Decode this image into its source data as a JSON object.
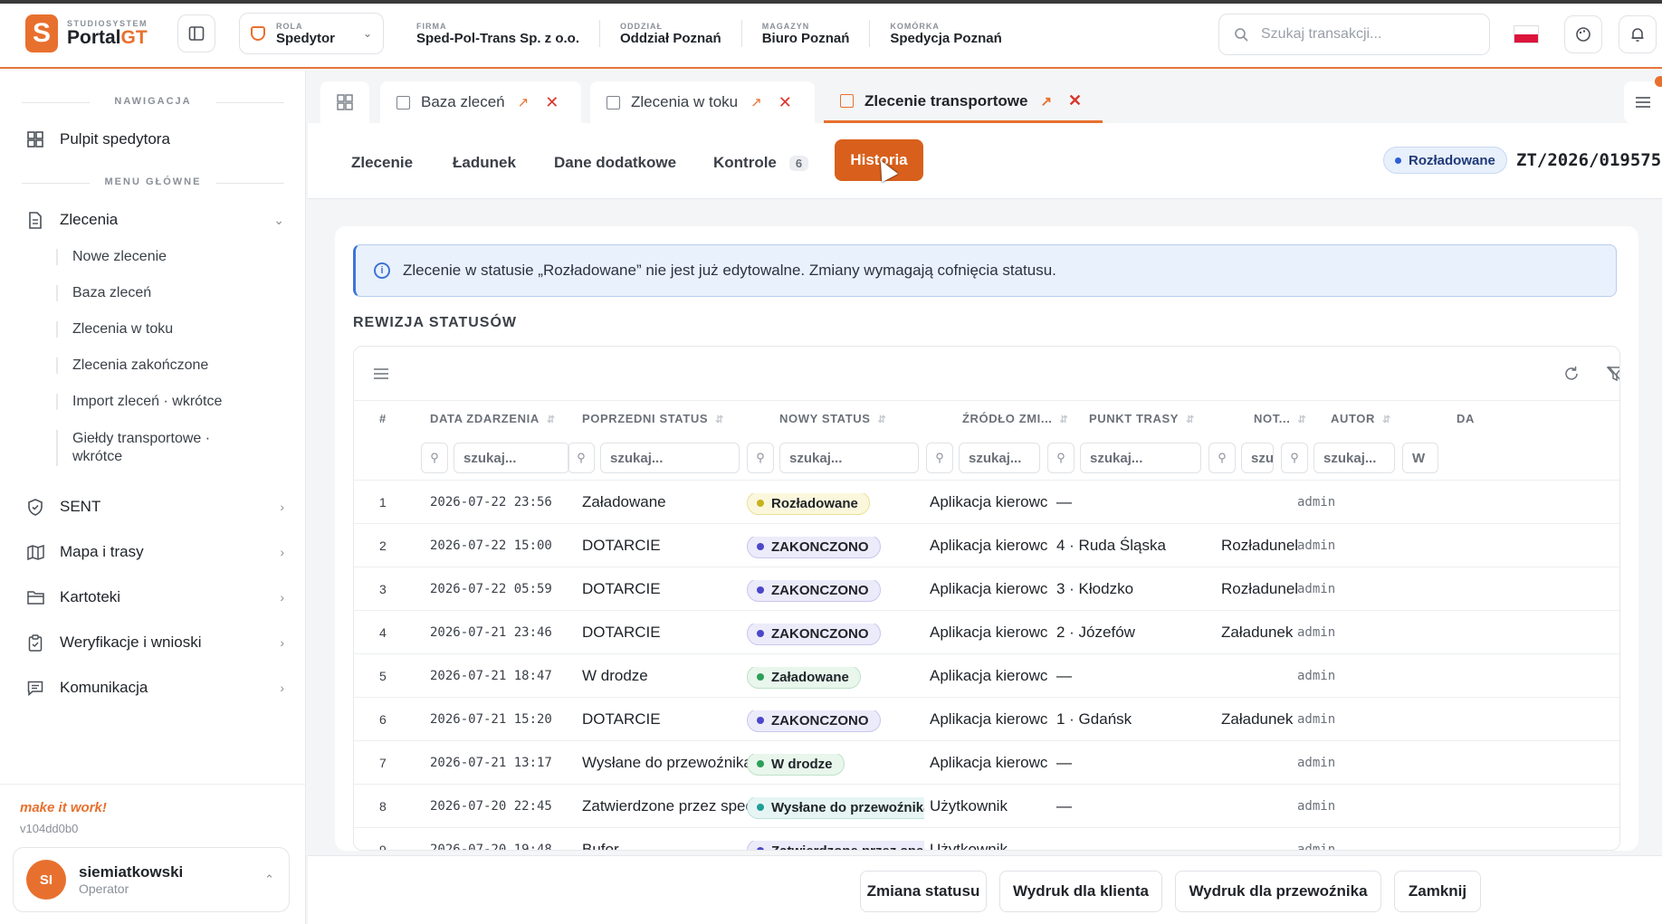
{
  "brand": {
    "small": "STUDIOSYSTEM",
    "name_a": "Portal",
    "name_b": "GT",
    "logo_letter": "S"
  },
  "header": {
    "role_label": "ROLA",
    "role_value": "Spedytor",
    "meta": [
      {
        "label": "FIRMA",
        "value": "Sped-Pol-Trans Sp. z o.o."
      },
      {
        "label": "ODDZIAŁ",
        "value": "Oddział Poznań"
      },
      {
        "label": "MAGAZYN",
        "value": "Biuro Poznań"
      },
      {
        "label": "KOMÓRKA",
        "value": "Spedycja Poznań"
      }
    ],
    "search_placeholder": "Szukaj transakcji..."
  },
  "sidebar": {
    "nav_title": "NAWIGACJA",
    "dashboard": "Pulpit spedytora",
    "menu_title": "MENU GŁÓWNE",
    "orders": "Zlecenia",
    "orders_sub": [
      "Nowe zlecenie",
      "Baza zleceń",
      "Zlecenia w toku",
      "Zlecenia zakończone",
      "Import zleceń · wkrótce",
      "Giełdy transportowe · wkrótce"
    ],
    "items": [
      "SENT",
      "Mapa i trasy",
      "Kartoteki",
      "Weryfikacje i wnioski",
      "Komunikacja"
    ],
    "tagline": "make it work!",
    "version": "v104dd0b0",
    "user": {
      "initials": "SI",
      "name": "siemiatkowski",
      "role": "Operator"
    }
  },
  "tabs": [
    {
      "label": "Baza zleceń"
    },
    {
      "label": "Zlecenia w toku"
    },
    {
      "label": "Zlecenie transportowe"
    }
  ],
  "subtabs": {
    "order": "Zlecenie",
    "cargo": "Ładunek",
    "extra": "Dane dodatkowe",
    "checks": "Kontrole",
    "checks_count": "6",
    "history": "Historia"
  },
  "order": {
    "status": "Rozładowane",
    "number": "ZT/2026/019575"
  },
  "info_text": "Zlecenie w statusie „Rozładowane” nie jest już edytowalne. Zmiany wymagają cofnięcia statusu.",
  "section_title": "REWIZJA STATUSÓW",
  "table": {
    "columns": [
      "#",
      "DATA ZDARZENIA",
      "POPRZEDNI STATUS",
      "NOWY STATUS",
      "ŹRÓDŁO ZMI...",
      "PUNKT TRASY",
      "NOT...",
      "AUTOR",
      "DA"
    ],
    "filter_placeholder": "szukaj...",
    "filter_short": "szu",
    "filter_last": "W",
    "rows": [
      {
        "n": "1",
        "date": "2026-07-22 23:56",
        "prev": "Załadowane",
        "new": "Rozładowane",
        "tone": "yellow",
        "src": "Aplikacja kierowcy",
        "point": "—",
        "note": "",
        "author": "admin"
      },
      {
        "n": "2",
        "date": "2026-07-22 15:00",
        "prev": "DOTARCIE",
        "new": "ZAKONCZONO",
        "tone": "blue",
        "src": "Aplikacja kierowcy",
        "point": "4 · Ruda Śląska",
        "note": "Rozładunek",
        "author": "admin"
      },
      {
        "n": "3",
        "date": "2026-07-22 05:59",
        "prev": "DOTARCIE",
        "new": "ZAKONCZONO",
        "tone": "blue",
        "src": "Aplikacja kierowcy",
        "point": "3 · Kłodzko",
        "note": "Rozładunek",
        "author": "admin"
      },
      {
        "n": "4",
        "date": "2026-07-21 23:46",
        "prev": "DOTARCIE",
        "new": "ZAKONCZONO",
        "tone": "blue",
        "src": "Aplikacja kierowcy",
        "point": "2 · Józefów",
        "note": "Załadunek",
        "author": "admin"
      },
      {
        "n": "5",
        "date": "2026-07-21 18:47",
        "prev": "W drodze",
        "new": "Załadowane",
        "tone": "green",
        "src": "Aplikacja kierowcy",
        "point": "—",
        "note": "",
        "author": "admin"
      },
      {
        "n": "6",
        "date": "2026-07-21 15:20",
        "prev": "DOTARCIE",
        "new": "ZAKONCZONO",
        "tone": "blue",
        "src": "Aplikacja kierowcy",
        "point": "1 · Gdańsk",
        "note": "Załadunek",
        "author": "admin"
      },
      {
        "n": "7",
        "date": "2026-07-21 13:17",
        "prev": "Wysłane do przewoźnika",
        "new": "W drodze",
        "tone": "green",
        "src": "Aplikacja kierowcy",
        "point": "—",
        "note": "",
        "author": "admin"
      },
      {
        "n": "8",
        "date": "2026-07-20 22:45",
        "prev": "Zatwierdzone przez spedytora",
        "new": "Wysłane do przewoźnika",
        "tone": "teal",
        "src": "Użytkownik",
        "point": "—",
        "note": "",
        "author": "admin"
      },
      {
        "n": "9",
        "date": "2026-07-20 19:48",
        "prev": "Bufor",
        "new": "Zatwierdzone przez spedytora",
        "tone": "blue",
        "src": "Użytkownik",
        "point": "—",
        "note": "",
        "author": "admin"
      }
    ]
  },
  "footer": {
    "change_status": "Zmiana statusu",
    "print_client": "Wydruk dla klienta",
    "print_carrier": "Wydruk dla przewoźnika",
    "close": "Zamknij"
  },
  "colors": {
    "accent": "#e8702e",
    "info": "#3f74d6"
  }
}
